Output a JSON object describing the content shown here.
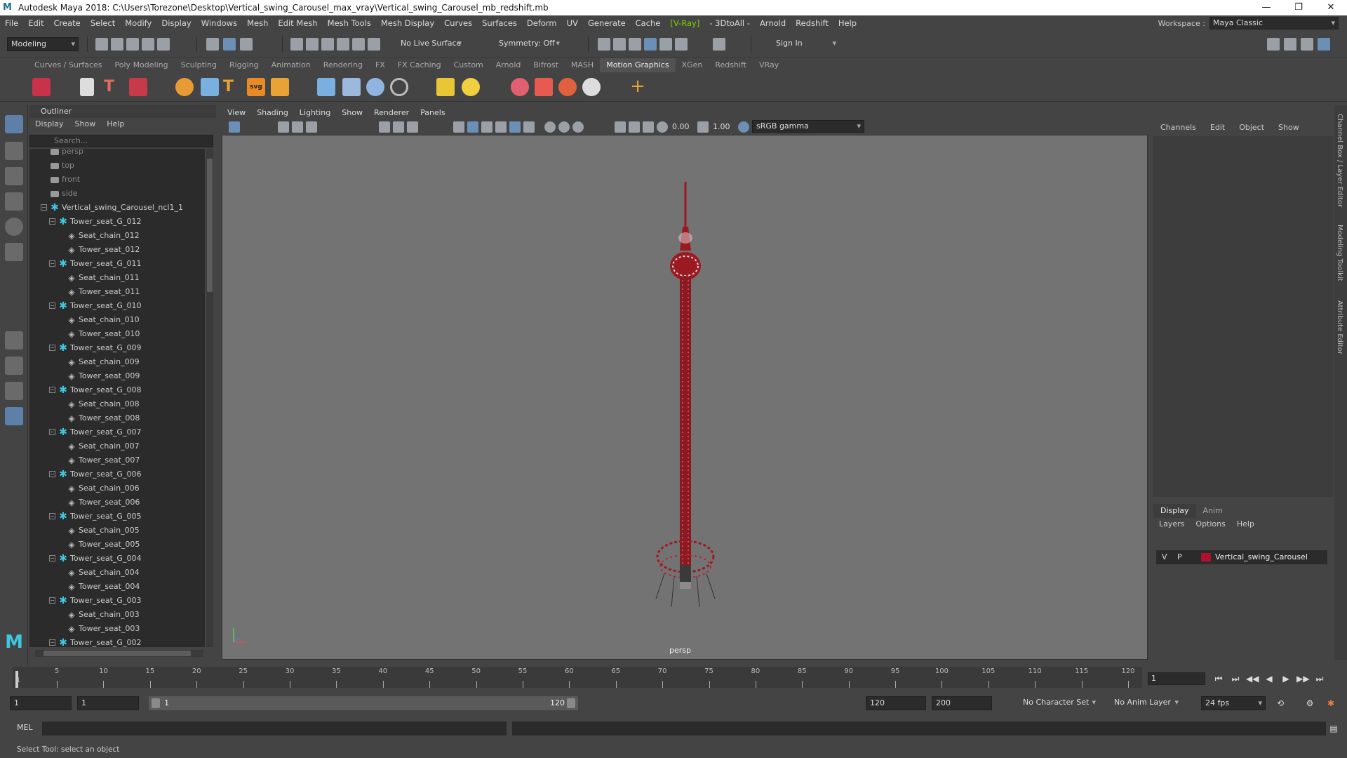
{
  "window": {
    "title": "Autodesk Maya 2018: C:\\Users\\Torezone\\Desktop\\Vertical_swing_Carousel_max_vray\\Vertical_swing_Carousel_mb_redshift.mb",
    "logo_letter": "M",
    "minimize": "—",
    "maximize": "❐",
    "close": "✕"
  },
  "menubar": {
    "items": [
      "File",
      "Edit",
      "Create",
      "Select",
      "Modify",
      "Display",
      "Windows",
      "Mesh",
      "Edit Mesh",
      "Mesh Tools",
      "Mesh Display",
      "Curves",
      "Surfaces",
      "Deform",
      "UV",
      "Generate",
      "Cache",
      "[V-Ray]",
      "- 3DtoAll -",
      "Arnold",
      "Redshift",
      "Help"
    ],
    "workspace_label": "Workspace :",
    "workspace_value": "Maya Classic"
  },
  "statusline": {
    "mode": "Modeling",
    "live_surface": "No Live Surface",
    "symmetry": "Symmetry: Off",
    "sign_in": "Sign In"
  },
  "shelf": {
    "tabs": [
      "Curves / Surfaces",
      "Poly Modeling",
      "Sculpting",
      "Rigging",
      "Animation",
      "Rendering",
      "FX",
      "FX Caching",
      "Custom",
      "Arnold",
      "Bifrost",
      "MASH",
      "Motion Graphics",
      "XGen",
      "Redshift",
      "VRay"
    ],
    "active_tab": "Motion Graphics",
    "icon_text_t": "T",
    "icon_text_svg": "svg"
  },
  "outliner": {
    "title": "Outliner",
    "menu": [
      "Display",
      "Show",
      "Help"
    ],
    "search_placeholder": "Search...",
    "cameras": [
      "persp",
      "top",
      "front",
      "side"
    ],
    "root": "Vertical_swing_Carousel_ncl1_1",
    "groups": [
      {
        "name": "Tower_seat_G_012",
        "chain": "Seat_chain_012",
        "seat": "Tower_seat_012"
      },
      {
        "name": "Tower_seat_G_011",
        "chain": "Seat_chain_011",
        "seat": "Tower_seat_011"
      },
      {
        "name": "Tower_seat_G_010",
        "chain": "Seat_chain_010",
        "seat": "Tower_seat_010"
      },
      {
        "name": "Tower_seat_G_009",
        "chain": "Seat_chain_009",
        "seat": "Tower_seat_009"
      },
      {
        "name": "Tower_seat_G_008",
        "chain": "Seat_chain_008",
        "seat": "Tower_seat_008"
      },
      {
        "name": "Tower_seat_G_007",
        "chain": "Seat_chain_007",
        "seat": "Tower_seat_007"
      },
      {
        "name": "Tower_seat_G_006",
        "chain": "Seat_chain_006",
        "seat": "Tower_seat_006"
      },
      {
        "name": "Tower_seat_G_005",
        "chain": "Seat_chain_005",
        "seat": "Tower_seat_005"
      },
      {
        "name": "Tower_seat_G_004",
        "chain": "Seat_chain_004",
        "seat": "Tower_seat_004"
      },
      {
        "name": "Tower_seat_G_003",
        "chain": "Seat_chain_003",
        "seat": "Tower_seat_003"
      }
    ],
    "partial_last": "Tower_seat_G_002"
  },
  "viewport": {
    "menu": [
      "View",
      "Shading",
      "Lighting",
      "Show",
      "Renderer",
      "Panels"
    ],
    "exposure": "0.00",
    "gamma": "1.00",
    "colorspace": "sRGB gamma",
    "camera_label": "persp",
    "model_color": "#9b1a22"
  },
  "channelbox": {
    "menu": [
      "Channels",
      "Edit",
      "Object",
      "Show"
    ]
  },
  "layers": {
    "tabs": [
      "Display",
      "Anim"
    ],
    "menu": [
      "Layers",
      "Options",
      "Help"
    ],
    "row": {
      "v": "V",
      "p": "P",
      "name": "Vertical_swing_Carousel",
      "color": "#b0102a"
    }
  },
  "sidetabs": [
    "Channel Box / Layer Editor",
    "Modeling Toolkit",
    "Attribute Editor"
  ],
  "timeslider": {
    "ticks": [
      5,
      10,
      15,
      20,
      25,
      30,
      35,
      40,
      45,
      50,
      55,
      60,
      65,
      70,
      75,
      80,
      85,
      90,
      95,
      100,
      105,
      110,
      115,
      120
    ],
    "first_frame_label": "1",
    "current_frame": "1"
  },
  "playback": [
    "⏮",
    "⏭",
    "◀◀",
    "◀",
    "▶",
    "▶▶",
    "⏭"
  ],
  "range": {
    "start": "1",
    "playback_start": "1",
    "slider_start": "1",
    "slider_end": "120",
    "playback_end": "120",
    "end": "200",
    "character_set": "No Character Set",
    "anim_layer": "No Anim Layer",
    "fps": "24 fps"
  },
  "cmdline": {
    "label": "MEL"
  },
  "helpline": "Select Tool: select an object"
}
